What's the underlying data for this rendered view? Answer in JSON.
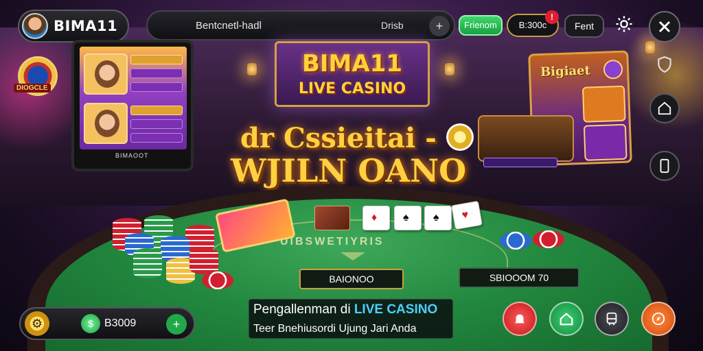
{
  "header": {
    "brand": "BIMA11",
    "search_text": "Bentcnetl-hadl",
    "search_right": "Drisb",
    "plus_label": "+",
    "green_button": "Frienom",
    "balance": "B:300c",
    "notification_badge": "!",
    "dark_button": "Fent",
    "settings_icon": "gear-icon",
    "close_icon": "close-icon"
  },
  "left_panel": {
    "emblem_text": "DIOGCLE",
    "phone_label": "BIMAOOT"
  },
  "sign": {
    "title": "BIMA11",
    "subtitle": "LIVE CASINO"
  },
  "headline": {
    "line1": "dr Cssieitai -",
    "line2": "WJILN OANO"
  },
  "promo_panel": {
    "title": "Bigiaet"
  },
  "table": {
    "arc_text": "UIBSWETIYRIS",
    "bet_left": "BAIONOO",
    "bet_right": "SBIOOOM 70"
  },
  "wallet": {
    "amount": "B3009",
    "add_label": "+"
  },
  "banner": {
    "line1_prefix": "Pengallenman di ",
    "line1_highlight": "LIVE CASINO",
    "line2": "Teer Bnehiusordi Ujung Jari Anda"
  },
  "colors": {
    "accent_gold": "#ffd040",
    "felt_green": "#238a40",
    "highlight_blue": "#4ad0ff",
    "button_green": "#22a84a",
    "button_red": "#e02030"
  },
  "side_icons": [
    "shield-icon",
    "home-icon",
    "phone-icon"
  ],
  "bottom_icons": [
    "bell-icon",
    "home-icon",
    "tram-icon",
    "compass-icon"
  ]
}
